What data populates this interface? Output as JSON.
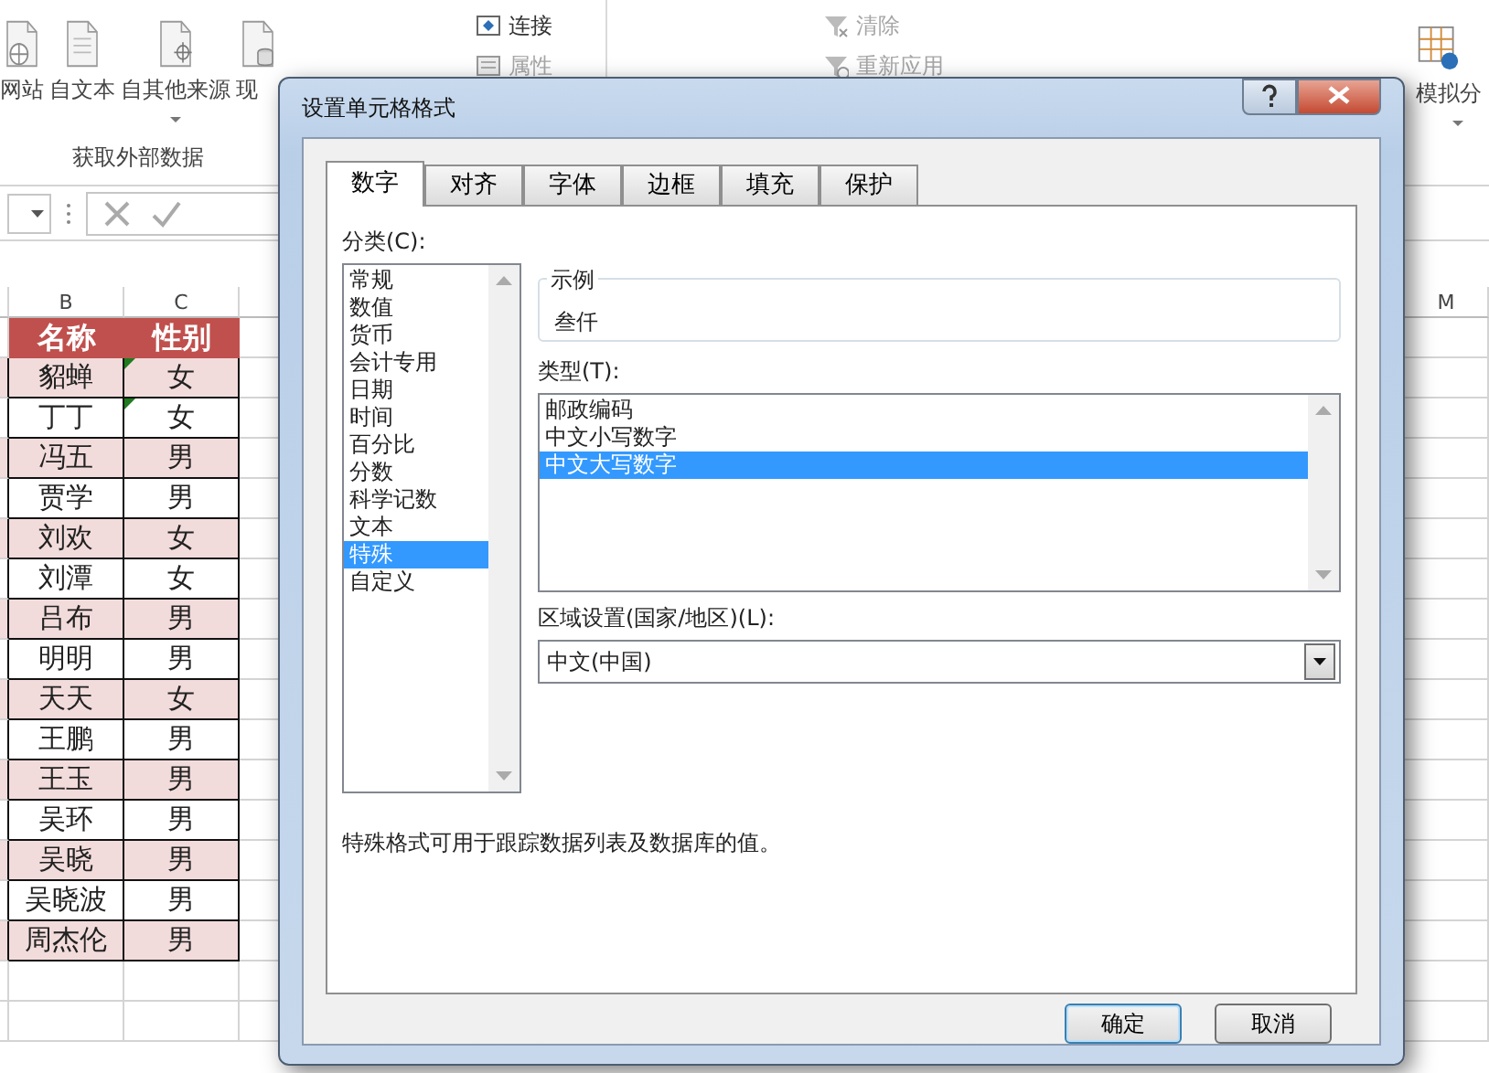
{
  "ribbon": {
    "big_buttons": [
      {
        "label": "网站",
        "dropdown": false
      },
      {
        "label": "自文本",
        "dropdown": false
      },
      {
        "label": "自其他来源",
        "dropdown": true
      },
      {
        "label": "现",
        "dropdown": false
      }
    ],
    "group_label": "获取外部数据",
    "small_buttons": [
      {
        "label": "连接",
        "disabled": false
      },
      {
        "label": "属性",
        "disabled": true
      },
      {
        "label": "清除",
        "disabled": true
      },
      {
        "label": "重新应用",
        "disabled": true
      }
    ],
    "right_button": {
      "label": "模拟分",
      "dropdown": true
    }
  },
  "sheet": {
    "columns": [
      "B",
      "C",
      "M"
    ],
    "header": [
      "名称",
      "性别"
    ],
    "rows": [
      {
        "cells": [
          "貂蝉",
          "女"
        ],
        "shaded": true,
        "flag": true
      },
      {
        "cells": [
          "丁丁",
          "女"
        ],
        "shaded": false,
        "flag": true
      },
      {
        "cells": [
          "冯五",
          "男"
        ],
        "shaded": true,
        "flag": false
      },
      {
        "cells": [
          "贾学",
          "男"
        ],
        "shaded": false,
        "flag": false
      },
      {
        "cells": [
          "刘欢",
          "女"
        ],
        "shaded": true,
        "flag": false
      },
      {
        "cells": [
          "刘潭",
          "女"
        ],
        "shaded": false,
        "flag": false
      },
      {
        "cells": [
          "吕布",
          "男"
        ],
        "shaded": true,
        "flag": false
      },
      {
        "cells": [
          "明明",
          "男"
        ],
        "shaded": false,
        "flag": false
      },
      {
        "cells": [
          "天天",
          "女"
        ],
        "shaded": true,
        "flag": false
      },
      {
        "cells": [
          "王鹏",
          "男"
        ],
        "shaded": false,
        "flag": false
      },
      {
        "cells": [
          "王玉",
          "男"
        ],
        "shaded": true,
        "flag": false
      },
      {
        "cells": [
          "吴环",
          "男"
        ],
        "shaded": false,
        "flag": false
      },
      {
        "cells": [
          "吴晓",
          "男"
        ],
        "shaded": true,
        "flag": false
      },
      {
        "cells": [
          "吴晓波",
          "男"
        ],
        "shaded": false,
        "flag": false
      },
      {
        "cells": [
          "周杰伦",
          "男"
        ],
        "shaded": true,
        "flag": false
      }
    ]
  },
  "dialog": {
    "title": "设置单元格格式",
    "tabs": [
      {
        "label": "数字",
        "selected": true
      },
      {
        "label": "对齐",
        "selected": false
      },
      {
        "label": "字体",
        "selected": false
      },
      {
        "label": "边框",
        "selected": false
      },
      {
        "label": "填充",
        "selected": false
      },
      {
        "label": "保护",
        "selected": false
      }
    ],
    "category_label": "分类(C):",
    "categories": [
      {
        "label": "常规",
        "selected": false
      },
      {
        "label": "数值",
        "selected": false
      },
      {
        "label": "货币",
        "selected": false
      },
      {
        "label": "会计专用",
        "selected": false
      },
      {
        "label": "日期",
        "selected": false
      },
      {
        "label": "时间",
        "selected": false
      },
      {
        "label": "百分比",
        "selected": false
      },
      {
        "label": "分数",
        "selected": false
      },
      {
        "label": "科学记数",
        "selected": false
      },
      {
        "label": "文本",
        "selected": false
      },
      {
        "label": "特殊",
        "selected": true
      },
      {
        "label": "自定义",
        "selected": false
      }
    ],
    "sample_label": "示例",
    "sample_value": "叁仟",
    "type_label": "类型(T):",
    "types": [
      {
        "label": "邮政编码",
        "selected": false
      },
      {
        "label": "中文小写数字",
        "selected": false
      },
      {
        "label": "中文大写数字",
        "selected": true
      }
    ],
    "locale_label": "区域设置(国家/地区)(L):",
    "locale_value": "中文(中国)",
    "description": "特殊格式可用于跟踪数据列表及数据库的值。",
    "buttons": [
      {
        "label": "确定",
        "default": true
      },
      {
        "label": "取消",
        "default": false
      }
    ]
  }
}
